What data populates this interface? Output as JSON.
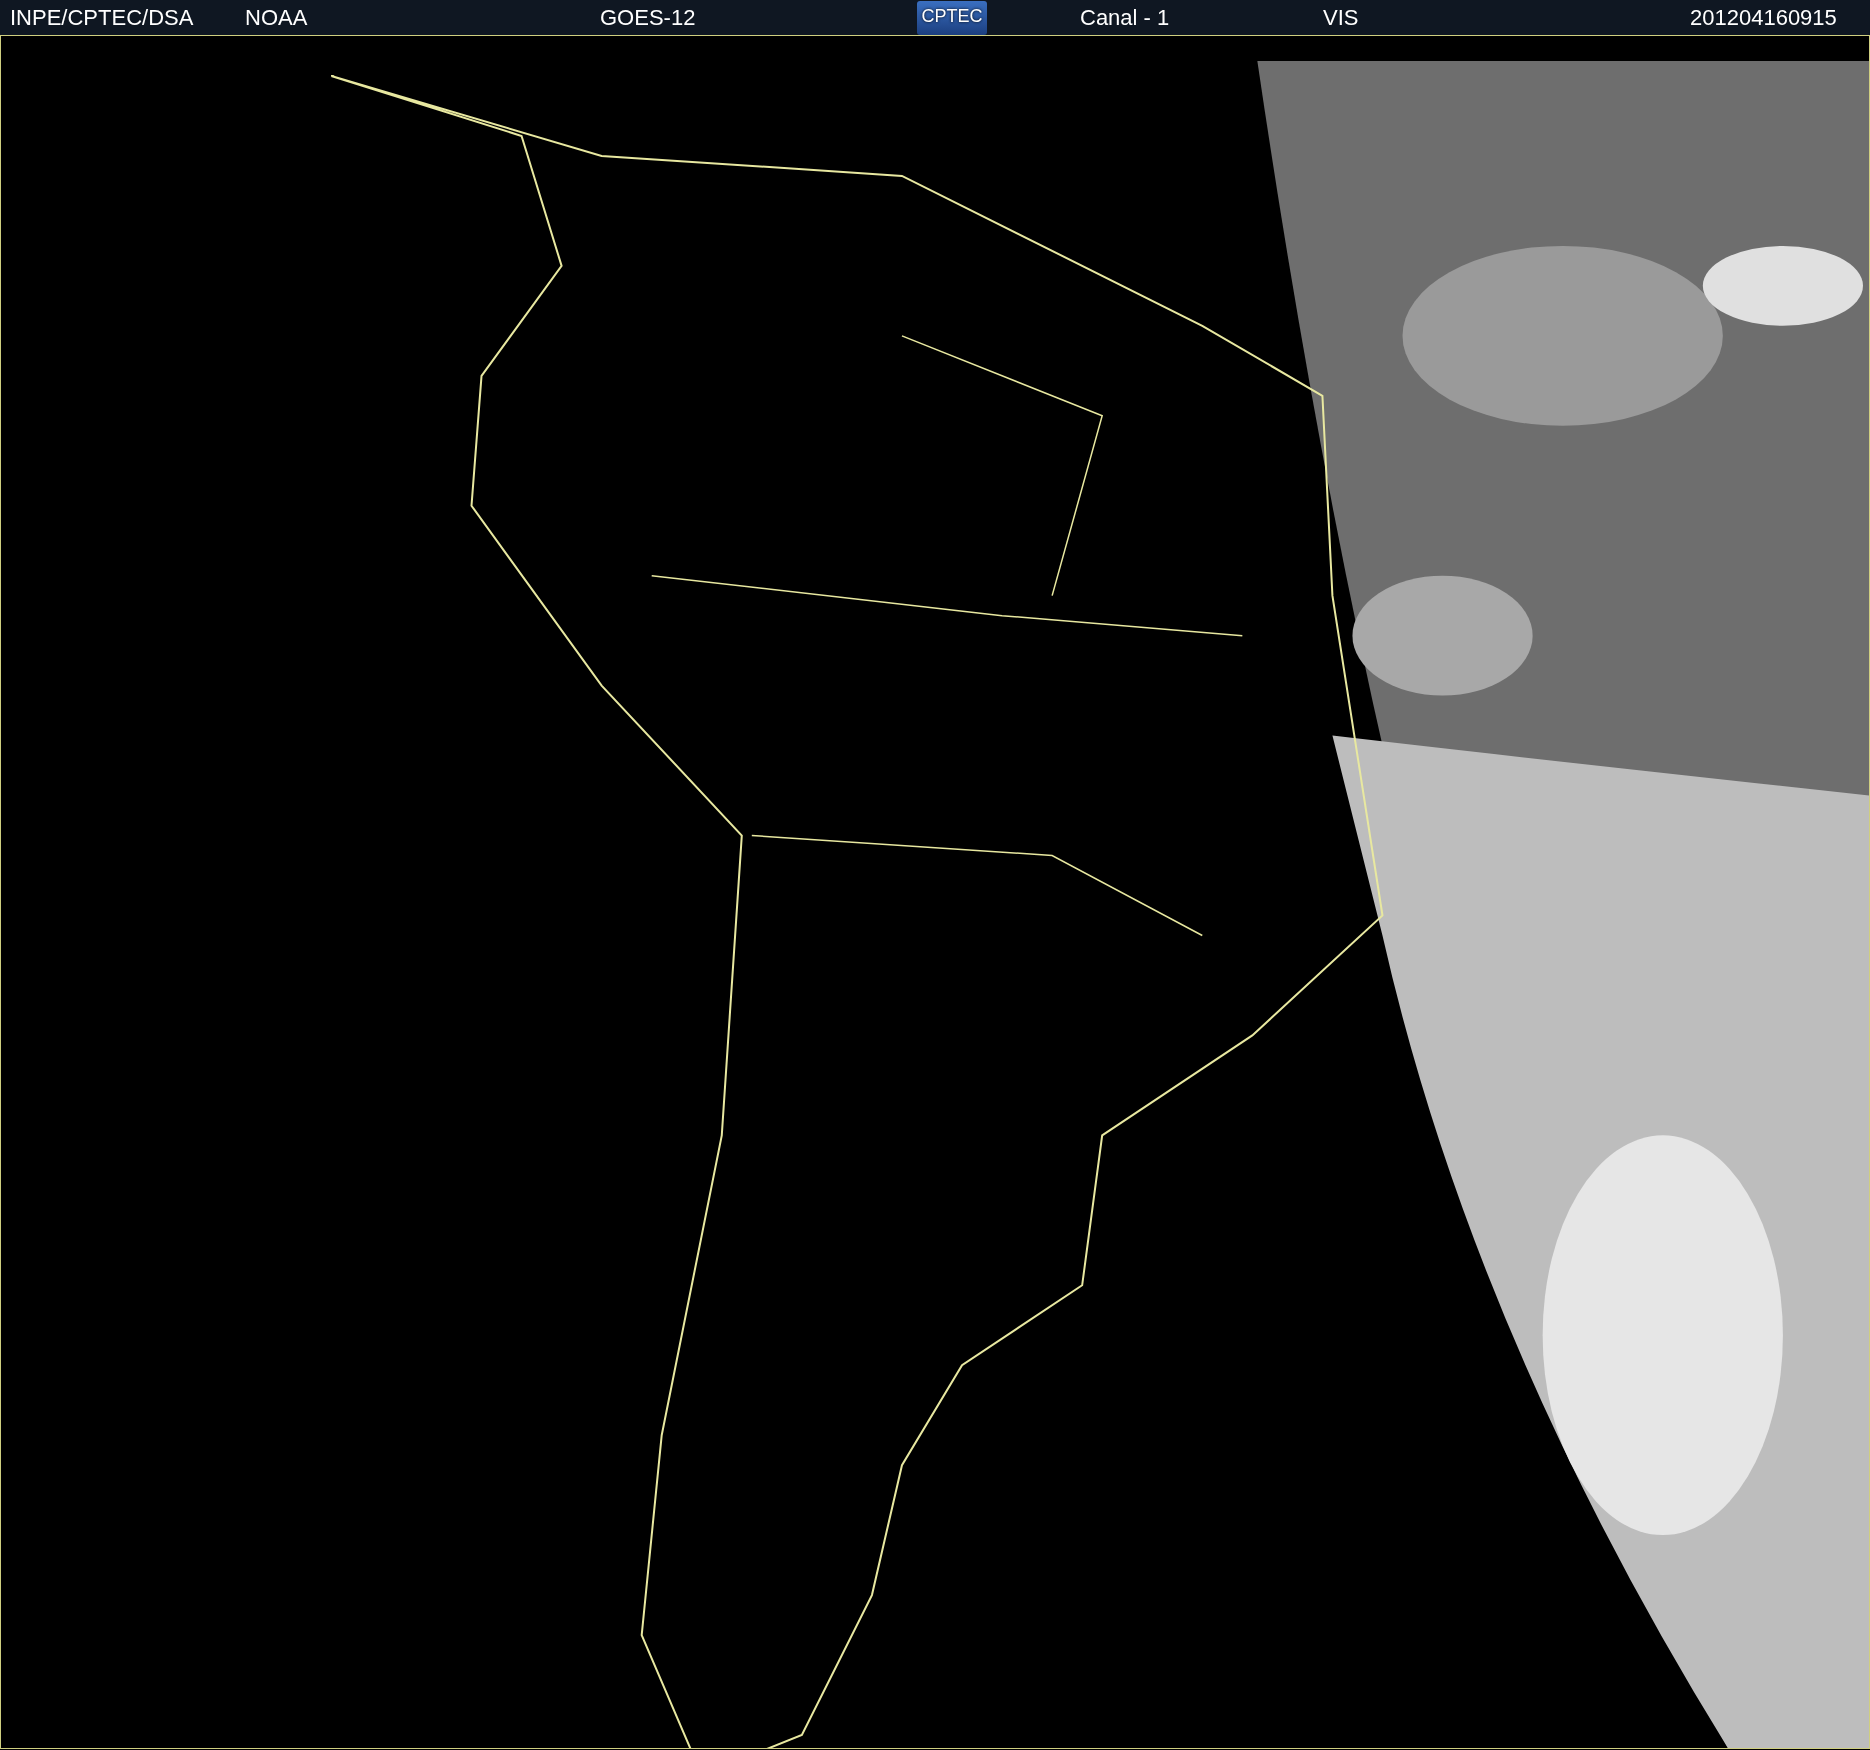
{
  "header": {
    "items": [
      {
        "kind": "text",
        "text": "INPE/CPTEC/DSA"
      },
      {
        "kind": "text",
        "text": "NOAA"
      },
      {
        "kind": "text",
        "text": "GOES-12"
      },
      {
        "kind": "logo",
        "text": "CPTEC"
      },
      {
        "kind": "text",
        "text": "Canal - 1"
      },
      {
        "kind": "text",
        "text": "VIS"
      },
      {
        "kind": "text",
        "text": "201204160915"
      }
    ]
  }
}
